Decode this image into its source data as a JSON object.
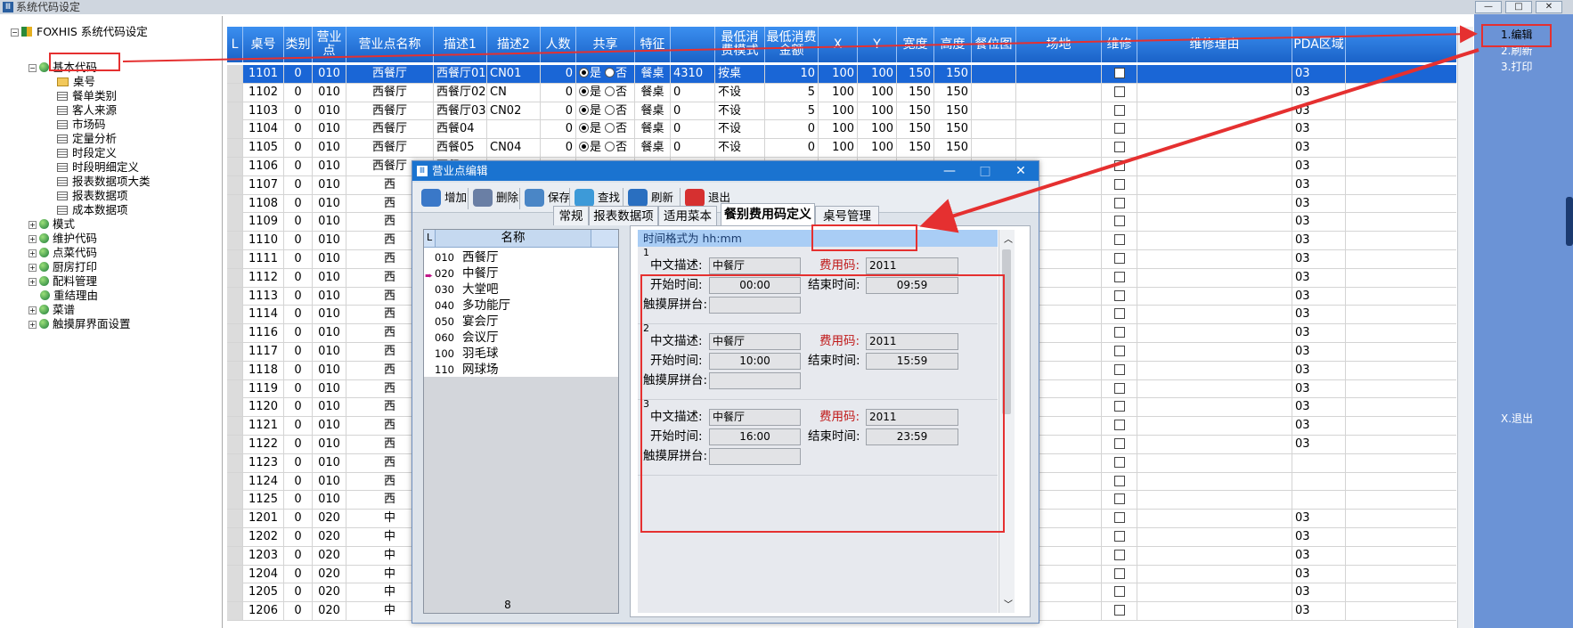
{
  "window": {
    "title": "系统代码设定",
    "controls": [
      "—",
      "□",
      "✕"
    ]
  },
  "tree": {
    "root": "FOXHIS 系统代码设定",
    "items": [
      {
        "label": "基本代码",
        "kind": "globe",
        "expander": "−",
        "level": 1
      },
      {
        "label": "桌号",
        "kind": "folder",
        "expander": "",
        "level": 2
      },
      {
        "label": "餐单类别",
        "kind": "page",
        "expander": "",
        "level": 2
      },
      {
        "label": "客人来源",
        "kind": "page",
        "expander": "",
        "level": 2
      },
      {
        "label": "市场码",
        "kind": "page",
        "expander": "",
        "level": 2
      },
      {
        "label": "定量分析",
        "kind": "page",
        "expander": "",
        "level": 2
      },
      {
        "label": "时段定义",
        "kind": "page",
        "expander": "",
        "level": 2
      },
      {
        "label": "时段明细定义",
        "kind": "page",
        "expander": "",
        "level": 2
      },
      {
        "label": "报表数据项大类",
        "kind": "page",
        "expander": "",
        "level": 2
      },
      {
        "label": "报表数据项",
        "kind": "page",
        "expander": "",
        "level": 2
      },
      {
        "label": "成本数据项",
        "kind": "page",
        "expander": "",
        "level": 2
      },
      {
        "label": "模式",
        "kind": "globe",
        "expander": "+",
        "level": 1
      },
      {
        "label": "维护代码",
        "kind": "globe",
        "expander": "+",
        "level": 1
      },
      {
        "label": "点菜代码",
        "kind": "globe",
        "expander": "+",
        "level": 1
      },
      {
        "label": "厨房打印",
        "kind": "globe",
        "expander": "+",
        "level": 1
      },
      {
        "label": "配料管理",
        "kind": "globe",
        "expander": "+",
        "level": 1
      },
      {
        "label": "重结理由",
        "kind": "globe",
        "expander": "",
        "level": 1
      },
      {
        "label": "菜谱",
        "kind": "globe",
        "expander": "+",
        "level": 1
      },
      {
        "label": "触摸屏界面设置",
        "kind": "globe",
        "expander": "+",
        "level": 1
      }
    ]
  },
  "grid": {
    "headers": [
      "L",
      "桌号",
      "类别",
      "营业点",
      "营业点名称",
      "描述1",
      "描述2",
      "人数",
      "共享",
      "特征",
      "",
      "最低消费模式",
      "最低消费金额",
      "X",
      "Y",
      "宽度",
      "高度",
      "餐位图",
      "场地",
      "维修",
      "维修理由",
      "PDA区域"
    ],
    "rows": [
      {
        "no": "1101",
        "cat": "0",
        "pt": "010",
        "ptname": "西餐厅",
        "d1": "西餐厅01",
        "d2": "CN01",
        "n": "0",
        "share": "yes",
        "feat": "餐桌",
        "x1": "4310",
        "mode": "按桌",
        "amt": "10",
        "x": "100",
        "y": "100",
        "w": "150",
        "h": "150",
        "pda": "03"
      },
      {
        "no": "1102",
        "cat": "0",
        "pt": "010",
        "ptname": "西餐厅",
        "d1": "西餐厅02",
        "d2": "CN",
        "n": "0",
        "share": "yes",
        "feat": "餐桌",
        "x1": "0",
        "mode": "不设",
        "amt": "5",
        "x": "100",
        "y": "100",
        "w": "150",
        "h": "150",
        "pda": "03"
      },
      {
        "no": "1103",
        "cat": "0",
        "pt": "010",
        "ptname": "西餐厅",
        "d1": "西餐厅03",
        "d2": "CN02",
        "n": "0",
        "share": "yes",
        "feat": "餐桌",
        "x1": "0",
        "mode": "不设",
        "amt": "5",
        "x": "100",
        "y": "100",
        "w": "150",
        "h": "150",
        "pda": "03"
      },
      {
        "no": "1104",
        "cat": "0",
        "pt": "010",
        "ptname": "西餐厅",
        "d1": "西餐04",
        "d2": "",
        "n": "0",
        "share": "yes",
        "feat": "餐桌",
        "x1": "0",
        "mode": "不设",
        "amt": "0",
        "x": "100",
        "y": "100",
        "w": "150",
        "h": "150",
        "pda": "03"
      },
      {
        "no": "1105",
        "cat": "0",
        "pt": "010",
        "ptname": "西餐厅",
        "d1": "西餐05",
        "d2": "CN04",
        "n": "0",
        "share": "yes",
        "feat": "餐桌",
        "x1": "0",
        "mode": "不设",
        "amt": "0",
        "x": "100",
        "y": "100",
        "w": "150",
        "h": "150",
        "pda": "03"
      },
      {
        "no": "1106",
        "cat": "0",
        "pt": "010",
        "ptname": "西餐厅",
        "d1": "西餐",
        "d2": "",
        "n": "",
        "share": "",
        "feat": "",
        "x1": "",
        "mode": "",
        "amt": "",
        "x": "",
        "y": "",
        "w": "",
        "h": "",
        "pda": "03"
      },
      {
        "no": "1107",
        "cat": "0",
        "pt": "010",
        "ptname": "西",
        "d1": "",
        "d2": "",
        "n": "",
        "share": "",
        "feat": "",
        "x1": "",
        "mode": "",
        "amt": "",
        "x": "",
        "y": "",
        "w": "",
        "h": "",
        "pda": "03"
      },
      {
        "no": "1108",
        "cat": "0",
        "pt": "010",
        "ptname": "西",
        "d1": "",
        "d2": "",
        "n": "",
        "share": "",
        "feat": "",
        "x1": "",
        "mode": "",
        "amt": "",
        "x": "",
        "y": "",
        "w": "",
        "h": "",
        "pda": "03"
      },
      {
        "no": "1109",
        "cat": "0",
        "pt": "010",
        "ptname": "西",
        "d1": "",
        "d2": "",
        "n": "",
        "share": "",
        "feat": "",
        "x1": "",
        "mode": "",
        "amt": "",
        "x": "",
        "y": "",
        "w": "",
        "h": "",
        "pda": "03"
      },
      {
        "no": "1110",
        "cat": "0",
        "pt": "010",
        "ptname": "西",
        "d1": "",
        "d2": "",
        "n": "",
        "share": "",
        "feat": "",
        "x1": "",
        "mode": "",
        "amt": "",
        "x": "",
        "y": "",
        "w": "",
        "h": "",
        "pda": "03"
      },
      {
        "no": "1111",
        "cat": "0",
        "pt": "010",
        "ptname": "西",
        "d1": "",
        "d2": "",
        "n": "",
        "share": "",
        "feat": "",
        "x1": "",
        "mode": "",
        "amt": "",
        "x": "",
        "y": "",
        "w": "",
        "h": "",
        "pda": "03"
      },
      {
        "no": "1112",
        "cat": "0",
        "pt": "010",
        "ptname": "西",
        "d1": "",
        "d2": "",
        "n": "",
        "share": "",
        "feat": "",
        "x1": "",
        "mode": "",
        "amt": "",
        "x": "",
        "y": "",
        "w": "",
        "h": "",
        "pda": "03"
      },
      {
        "no": "1113",
        "cat": "0",
        "pt": "010",
        "ptname": "西",
        "d1": "",
        "d2": "",
        "n": "",
        "share": "",
        "feat": "",
        "x1": "",
        "mode": "",
        "amt": "",
        "x": "",
        "y": "",
        "w": "",
        "h": "",
        "pda": "03"
      },
      {
        "no": "1114",
        "cat": "0",
        "pt": "010",
        "ptname": "西",
        "d1": "",
        "d2": "",
        "n": "",
        "share": "",
        "feat": "",
        "x1": "",
        "mode": "",
        "amt": "",
        "x": "",
        "y": "",
        "w": "",
        "h": "",
        "pda": "03"
      },
      {
        "no": "1116",
        "cat": "0",
        "pt": "010",
        "ptname": "西",
        "d1": "",
        "d2": "",
        "n": "",
        "share": "",
        "feat": "",
        "x1": "",
        "mode": "",
        "amt": "",
        "x": "",
        "y": "",
        "w": "",
        "h": "",
        "pda": "03"
      },
      {
        "no": "1117",
        "cat": "0",
        "pt": "010",
        "ptname": "西",
        "d1": "",
        "d2": "",
        "n": "",
        "share": "",
        "feat": "",
        "x1": "",
        "mode": "",
        "amt": "",
        "x": "",
        "y": "",
        "w": "",
        "h": "",
        "pda": "03"
      },
      {
        "no": "1118",
        "cat": "0",
        "pt": "010",
        "ptname": "西",
        "d1": "",
        "d2": "",
        "n": "",
        "share": "",
        "feat": "",
        "x1": "",
        "mode": "",
        "amt": "",
        "x": "",
        "y": "",
        "w": "",
        "h": "",
        "pda": "03"
      },
      {
        "no": "1119",
        "cat": "0",
        "pt": "010",
        "ptname": "西",
        "d1": "",
        "d2": "",
        "n": "",
        "share": "",
        "feat": "",
        "x1": "",
        "mode": "",
        "amt": "",
        "x": "",
        "y": "",
        "w": "",
        "h": "",
        "pda": "03"
      },
      {
        "no": "1120",
        "cat": "0",
        "pt": "010",
        "ptname": "西",
        "d1": "",
        "d2": "",
        "n": "",
        "share": "",
        "feat": "",
        "x1": "",
        "mode": "",
        "amt": "",
        "x": "",
        "y": "",
        "w": "",
        "h": "",
        "pda": "03"
      },
      {
        "no": "1121",
        "cat": "0",
        "pt": "010",
        "ptname": "西",
        "d1": "",
        "d2": "",
        "n": "",
        "share": "",
        "feat": "",
        "x1": "",
        "mode": "",
        "amt": "",
        "x": "",
        "y": "",
        "w": "",
        "h": "",
        "pda": "03"
      },
      {
        "no": "1122",
        "cat": "0",
        "pt": "010",
        "ptname": "西",
        "d1": "",
        "d2": "",
        "n": "",
        "share": "",
        "feat": "",
        "x1": "",
        "mode": "",
        "amt": "",
        "x": "",
        "y": "",
        "w": "",
        "h": "",
        "pda": "03"
      },
      {
        "no": "1123",
        "cat": "0",
        "pt": "010",
        "ptname": "西",
        "d1": "",
        "d2": "",
        "n": "",
        "share": "",
        "feat": "",
        "x1": "",
        "mode": "",
        "amt": "",
        "x": "",
        "y": "",
        "w": "",
        "h": "",
        "pda": ""
      },
      {
        "no": "1124",
        "cat": "0",
        "pt": "010",
        "ptname": "西",
        "d1": "",
        "d2": "",
        "n": "",
        "share": "",
        "feat": "",
        "x1": "",
        "mode": "",
        "amt": "",
        "x": "",
        "y": "",
        "w": "",
        "h": "",
        "pda": ""
      },
      {
        "no": "1125",
        "cat": "0",
        "pt": "010",
        "ptname": "西",
        "d1": "",
        "d2": "",
        "n": "",
        "share": "",
        "feat": "",
        "x1": "",
        "mode": "",
        "amt": "",
        "x": "",
        "y": "",
        "w": "",
        "h": "",
        "pda": ""
      },
      {
        "no": "1201",
        "cat": "0",
        "pt": "020",
        "ptname": "中",
        "d1": "",
        "d2": "",
        "n": "",
        "share": "",
        "feat": "",
        "x1": "",
        "mode": "",
        "amt": "",
        "x": "",
        "y": "",
        "w": "",
        "h": "",
        "pda": "03"
      },
      {
        "no": "1202",
        "cat": "0",
        "pt": "020",
        "ptname": "中",
        "d1": "",
        "d2": "",
        "n": "",
        "share": "",
        "feat": "",
        "x1": "",
        "mode": "",
        "amt": "",
        "x": "",
        "y": "",
        "w": "",
        "h": "",
        "pda": "03"
      },
      {
        "no": "1203",
        "cat": "0",
        "pt": "020",
        "ptname": "中",
        "d1": "",
        "d2": "",
        "n": "",
        "share": "",
        "feat": "",
        "x1": "",
        "mode": "",
        "amt": "",
        "x": "",
        "y": "",
        "w": "",
        "h": "",
        "pda": "03"
      },
      {
        "no": "1204",
        "cat": "0",
        "pt": "020",
        "ptname": "中",
        "d1": "",
        "d2": "",
        "n": "",
        "share": "",
        "feat": "",
        "x1": "",
        "mode": "",
        "amt": "",
        "x": "",
        "y": "",
        "w": "",
        "h": "",
        "pda": "03"
      },
      {
        "no": "1205",
        "cat": "0",
        "pt": "020",
        "ptname": "中",
        "d1": "",
        "d2": "",
        "n": "",
        "share": "",
        "feat": "",
        "x1": "",
        "mode": "",
        "amt": "",
        "x": "",
        "y": "",
        "w": "",
        "h": "",
        "pda": "03"
      },
      {
        "no": "1206",
        "cat": "0",
        "pt": "020",
        "ptname": "中",
        "d1": "",
        "d2": "",
        "n": "",
        "share": "",
        "feat": "",
        "x1": "",
        "mode": "",
        "amt": "",
        "x": "",
        "y": "",
        "w": "",
        "h": "",
        "pda": "03"
      }
    ],
    "yes_label": "是",
    "no_label": "否"
  },
  "right_menu": {
    "items": [
      "1.编辑",
      "2.刷新",
      "3.打印"
    ],
    "exit": "X.退出"
  },
  "dialog": {
    "title": "营业点编辑",
    "toolbar": [
      {
        "label": "增加",
        "icon": "add-icon",
        "color": "#3a78c8"
      },
      {
        "label": "删除",
        "icon": "delete-icon",
        "color": "#6a7fa5"
      },
      {
        "label": "保存",
        "icon": "save-icon",
        "color": "#4a86c6"
      },
      {
        "label": "查找",
        "icon": "find-icon",
        "color": "#3d9ad8"
      },
      {
        "label": "刷新",
        "icon": "refresh-icon",
        "color": "#2a6fc0"
      },
      {
        "label": "退出",
        "icon": "exit-icon",
        "color": "#d63030"
      }
    ],
    "list": {
      "header_l": "L",
      "header_name": "名称",
      "items": [
        {
          "code": "010",
          "name": "西餐厅"
        },
        {
          "code": "020",
          "name": "中餐厅"
        },
        {
          "code": "030",
          "name": "大堂吧"
        },
        {
          "code": "040",
          "name": "多功能厅"
        },
        {
          "code": "050",
          "name": "宴会厅"
        },
        {
          "code": "060",
          "name": "会议厅"
        },
        {
          "code": "100",
          "name": "羽毛球"
        },
        {
          "code": "110",
          "name": "网球场"
        }
      ],
      "count": "8"
    },
    "tabs": [
      "常规",
      "报表数据项",
      "适用菜本",
      "餐别费用码定义",
      "桌号管理"
    ],
    "active_tab": "餐别费用码定义",
    "time_format": "时间格式为  hh:mm",
    "labels": {
      "desc": "中文描述:",
      "fee": "费用码:",
      "start": "开始时间:",
      "end": "结束时间:",
      "touch": "触摸屏拼台:"
    },
    "groups": [
      {
        "num": "1",
        "desc": "中餐厅",
        "fee": "2011",
        "start": "00:00",
        "end": "09:59",
        "touch": ""
      },
      {
        "num": "2",
        "desc": "中餐厅",
        "fee": "2011",
        "start": "10:00",
        "end": "15:59",
        "touch": ""
      },
      {
        "num": "3",
        "desc": "中餐厅",
        "fee": "2011",
        "start": "16:00",
        "end": "23:59",
        "touch": ""
      }
    ]
  }
}
